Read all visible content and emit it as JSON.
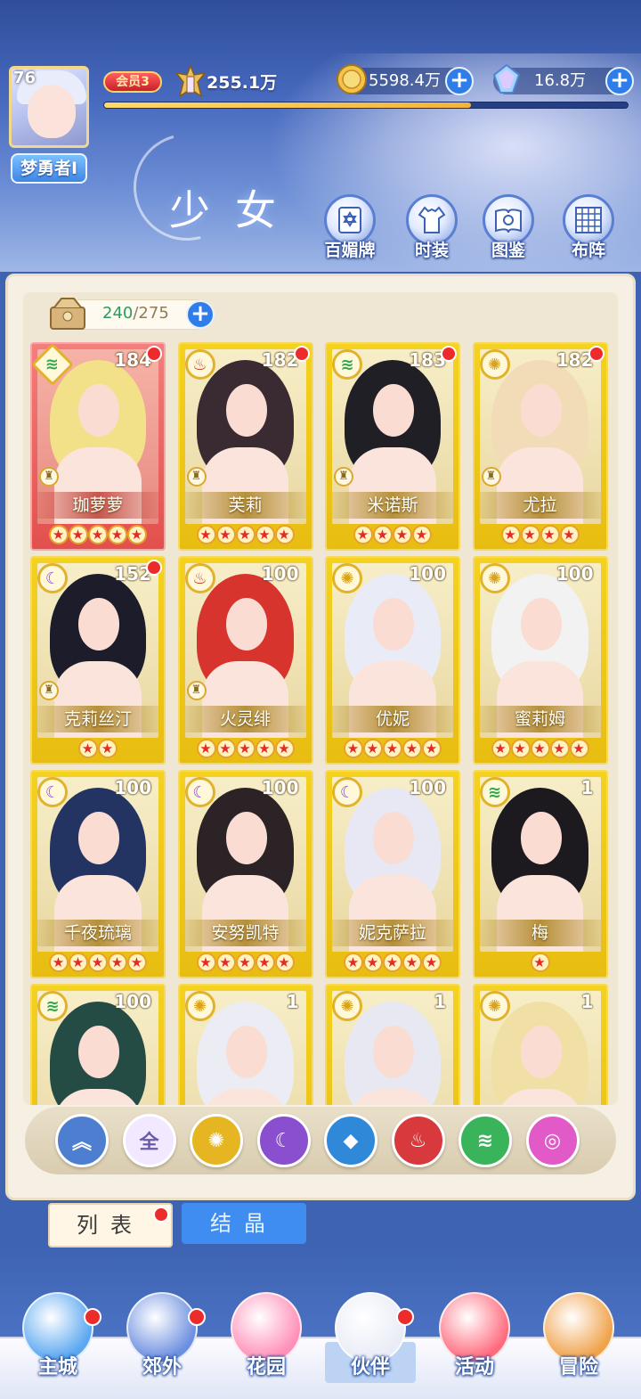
{
  "player": {
    "level": "76",
    "name": "梦勇者I",
    "vip": "会员3",
    "power": "255.1万",
    "exp_fraction": 0.7
  },
  "resources": {
    "gold": "5598.4万",
    "gems": "16.8万"
  },
  "page": {
    "title": "少女"
  },
  "quick_menu": [
    {
      "label": "百媚牌",
      "icon": "card-icon"
    },
    {
      "label": "时装",
      "icon": "outfit-icon"
    },
    {
      "label": "图鉴",
      "icon": "book-icon"
    },
    {
      "label": "布阵",
      "icon": "formation-grid-icon"
    }
  ],
  "bag": {
    "current": "240",
    "max": "/275"
  },
  "girls": [
    {
      "name": "珈萝萝",
      "level": "184",
      "element": "wind",
      "stars": 5,
      "rarity": "red",
      "dot": true,
      "chess": true
    },
    {
      "name": "芙莉",
      "level": "182",
      "element": "fire",
      "stars": 5,
      "rarity": "gold",
      "dot": true,
      "chess": true
    },
    {
      "name": "米诺斯",
      "level": "183",
      "element": "wind",
      "stars": 4,
      "rarity": "gold",
      "dot": true,
      "chess": true
    },
    {
      "name": "尤拉",
      "level": "182",
      "element": "light",
      "stars": 4,
      "rarity": "gold",
      "dot": true,
      "chess": true
    },
    {
      "name": "克莉丝汀",
      "level": "152",
      "element": "dark",
      "stars": 2,
      "rarity": "gold",
      "dot": true,
      "chess": true
    },
    {
      "name": "火灵绯",
      "level": "100",
      "element": "fire",
      "stars": 5,
      "rarity": "gold",
      "dot": false,
      "chess": true
    },
    {
      "name": "优妮",
      "level": "100",
      "element": "light",
      "stars": 5,
      "rarity": "gold",
      "dot": false,
      "chess": false
    },
    {
      "name": "蜜莉姆",
      "level": "100",
      "element": "light",
      "stars": 5,
      "rarity": "gold",
      "dot": false,
      "chess": false
    },
    {
      "name": "千夜琉璃",
      "level": "100",
      "element": "dark",
      "stars": 5,
      "rarity": "gold",
      "dot": false,
      "chess": false
    },
    {
      "name": "安努凯特",
      "level": "100",
      "element": "dark",
      "stars": 5,
      "rarity": "gold",
      "dot": false,
      "chess": false
    },
    {
      "name": "妮克萨拉",
      "level": "100",
      "element": "dark",
      "stars": 5,
      "rarity": "gold",
      "dot": false,
      "chess": false
    },
    {
      "name": "梅",
      "level": "1",
      "element": "wind",
      "stars": 1,
      "rarity": "gold",
      "dot": false,
      "chess": false
    },
    {
      "name": "",
      "level": "100",
      "element": "wind",
      "stars": 0,
      "rarity": "gold",
      "dot": false,
      "chess": false
    },
    {
      "name": "",
      "level": "1",
      "element": "light",
      "stars": 0,
      "rarity": "gold",
      "dot": false,
      "chess": false
    },
    {
      "name": "",
      "level": "1",
      "element": "light",
      "stars": 0,
      "rarity": "gold",
      "dot": false,
      "chess": false
    },
    {
      "name": "",
      "level": "1",
      "element": "light",
      "stars": 0,
      "rarity": "gold",
      "dot": false,
      "chess": false
    }
  ],
  "filters": [
    {
      "label": "",
      "icon": "collapse-icon",
      "color": "#4d7ecf"
    },
    {
      "label": "全",
      "icon": "all-icon",
      "color": "#f2e8ff"
    },
    {
      "label": "",
      "icon": "light-element-icon",
      "color": "#e6b622"
    },
    {
      "label": "",
      "icon": "dark-element-icon",
      "color": "#8a4fcf"
    },
    {
      "label": "",
      "icon": "water-element-icon",
      "color": "#2f88d8"
    },
    {
      "label": "",
      "icon": "fire-element-icon",
      "color": "#d8393c"
    },
    {
      "label": "",
      "icon": "wind-element-icon",
      "color": "#39b45a"
    },
    {
      "label": "",
      "icon": "heart-element-icon",
      "color": "#e15ac8"
    }
  ],
  "tabs": {
    "list": "列表",
    "crystal": "结晶"
  },
  "nav": [
    {
      "label": "主城",
      "icon": "castle-icon",
      "dot": true
    },
    {
      "label": "郊外",
      "icon": "portal-icon",
      "dot": true
    },
    {
      "label": "花园",
      "icon": "heart-garden-icon",
      "dot": false
    },
    {
      "label": "伙伴",
      "icon": "partner-icon",
      "dot": true
    },
    {
      "label": "活动",
      "icon": "gift-icon",
      "dot": false
    },
    {
      "label": "冒险",
      "icon": "compass-icon",
      "dot": false
    }
  ]
}
